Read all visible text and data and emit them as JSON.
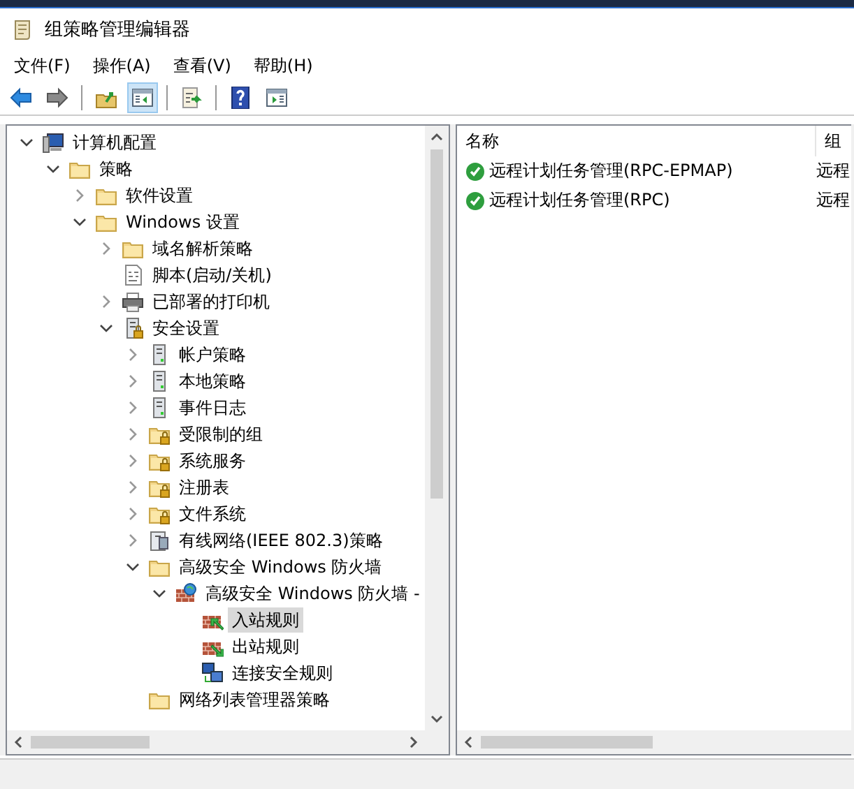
{
  "window": {
    "title": "组策略管理编辑器"
  },
  "menu": [
    "文件(F)",
    "操作(A)",
    "查看(V)",
    "帮助(H)"
  ],
  "toolbar": [
    [
      {
        "kind": "back",
        "selected": false
      },
      {
        "kind": "forward",
        "selected": false
      }
    ],
    [
      {
        "kind": "up",
        "selected": false
      },
      {
        "kind": "pane",
        "selected": true
      }
    ],
    [
      {
        "kind": "export",
        "selected": false
      }
    ],
    [
      {
        "kind": "help",
        "selected": false
      },
      {
        "kind": "panel",
        "selected": false
      }
    ]
  ],
  "tree": [
    {
      "label": "计算机配置",
      "kind": "computer",
      "expanded": true,
      "selected": false,
      "children": [
        {
          "label": "策略",
          "kind": "folder",
          "expanded": true,
          "selected": false,
          "children": [
            {
              "label": "软件设置",
              "kind": "folder",
              "expanded": false,
              "selected": false
            },
            {
              "label": "Windows 设置",
              "kind": "folder",
              "expanded": true,
              "selected": false,
              "children": [
                {
                  "label": "域名解析策略",
                  "kind": "folder",
                  "expanded": false,
                  "selected": false
                },
                {
                  "label": "脚本(启动/关机)",
                  "kind": "script",
                  "selected": false
                },
                {
                  "label": "已部署的打印机",
                  "kind": "printer",
                  "expanded": false,
                  "selected": false
                },
                {
                  "label": "安全设置",
                  "kind": "secserver",
                  "expanded": true,
                  "selected": false,
                  "children": [
                    {
                      "label": "帐户策略",
                      "kind": "server",
                      "expanded": false,
                      "selected": false
                    },
                    {
                      "label": "本地策略",
                      "kind": "server",
                      "expanded": false,
                      "selected": false
                    },
                    {
                      "label": "事件日志",
                      "kind": "server",
                      "expanded": false,
                      "selected": false
                    },
                    {
                      "label": "受限制的组",
                      "kind": "lockfolder",
                      "expanded": false,
                      "selected": false
                    },
                    {
                      "label": "系统服务",
                      "kind": "lockfolder",
                      "expanded": false,
                      "selected": false
                    },
                    {
                      "label": "注册表",
                      "kind": "lockfolder",
                      "expanded": false,
                      "selected": false
                    },
                    {
                      "label": "文件系统",
                      "kind": "lockfolder",
                      "expanded": false,
                      "selected": false
                    },
                    {
                      "label": "有线网络(IEEE 802.3)策略",
                      "kind": "network",
                      "expanded": false,
                      "selected": false
                    },
                    {
                      "label": "高级安全 Windows 防火墙",
                      "kind": "folder",
                      "expanded": true,
                      "selected": false,
                      "children": [
                        {
                          "label": "高级安全 Windows 防火墙 -",
                          "kind": "firewall",
                          "expanded": true,
                          "selected": false,
                          "children": [
                            {
                              "label": "入站规则",
                              "kind": "inbound",
                              "selected": true
                            },
                            {
                              "label": "出站规则",
                              "kind": "outbound",
                              "selected": false
                            },
                            {
                              "label": "连接安全规则",
                              "kind": "connection",
                              "selected": false
                            }
                          ]
                        }
                      ]
                    },
                    {
                      "label": "网络列表管理器策略",
                      "kind": "folder",
                      "selected": false
                    }
                  ]
                }
              ]
            }
          ]
        }
      ]
    }
  ],
  "list": {
    "columns": [
      "名称",
      "组"
    ],
    "rows": [
      {
        "name": "远程计划任务管理(RPC-EPMAP)",
        "group": "远程",
        "enabled": true
      },
      {
        "name": "远程计划任务管理(RPC)",
        "group": "远程",
        "enabled": true
      }
    ]
  }
}
